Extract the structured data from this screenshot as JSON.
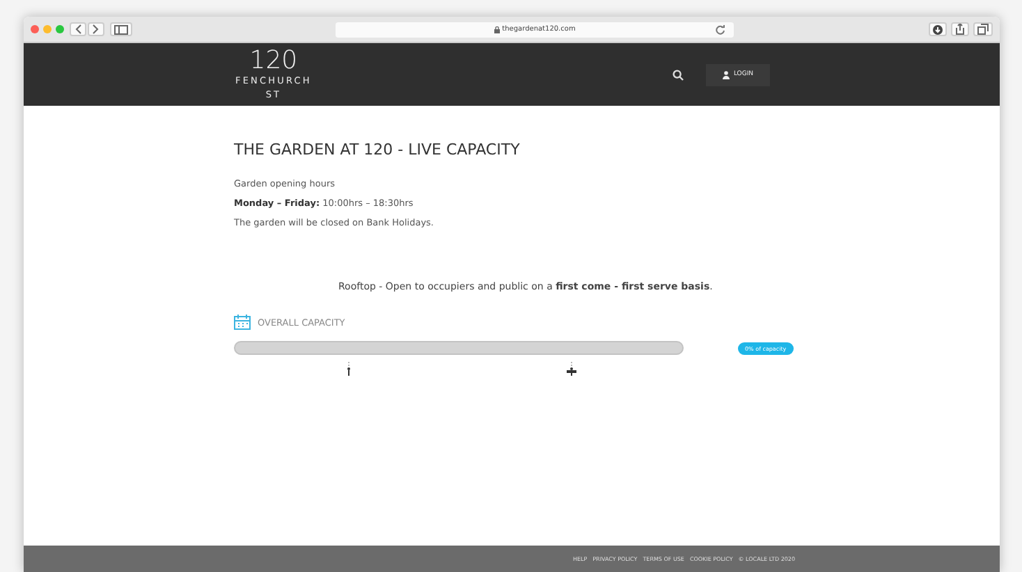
{
  "browser": {
    "url": "thegardenat120.com"
  },
  "header": {
    "logo_lines": [
      "120",
      "FENCHURCH",
      "ST"
    ],
    "login_label": "LOGIN"
  },
  "page": {
    "title": "THE GARDEN AT 120 - LIVE CAPACITY",
    "paragraphs": [
      "Garden opening hours",
      "**Monday – Friday:** 10:00hrs – 18:30hrs",
      "The garden will be closed on Bank Holidays."
    ],
    "notice": "Rooftop - Open to occupiers and public on a **first come - first serve basis**."
  },
  "capacity": {
    "label": "OVERALL CAPACITY",
    "level": 0,
    "badge": "0% of capacity"
  },
  "footer": {
    "links": [
      "HELP",
      "PRIVACY POLICY",
      "TERMS OF USE",
      "COOKIE POLICY",
      "© LOCALE LTD 2020"
    ]
  }
}
